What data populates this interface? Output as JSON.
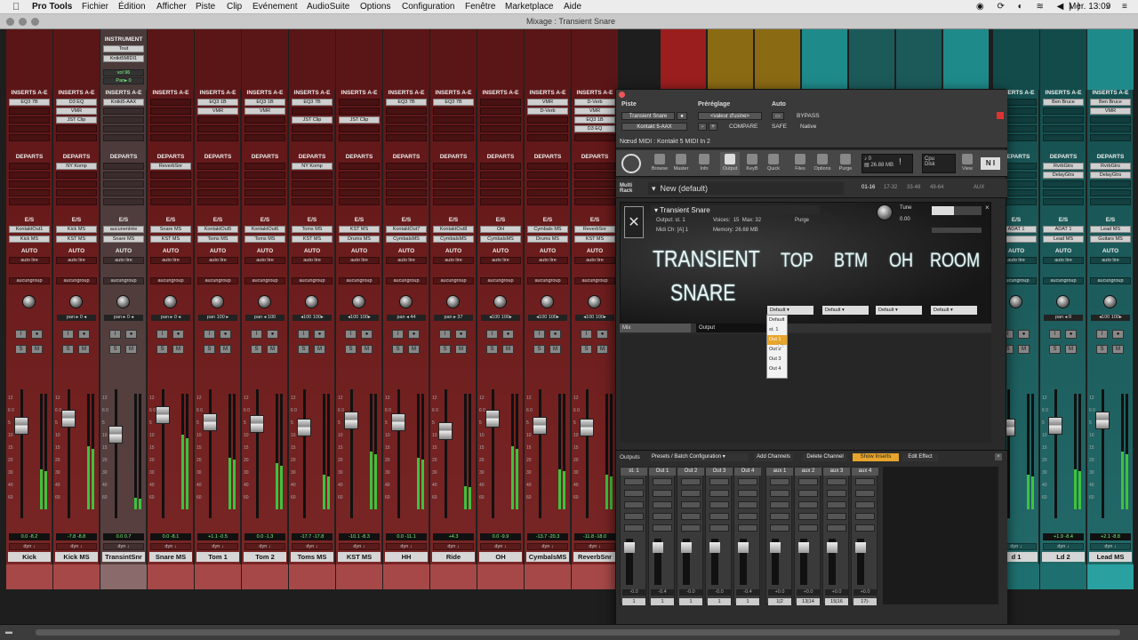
{
  "menubar": {
    "app": "Pro Tools",
    "items": [
      "Fichier",
      "Édition",
      "Afficher",
      "Piste",
      "Clip",
      "Evénement",
      "AudioSuite",
      "Options",
      "Configuration",
      "Fenêtre",
      "Marketplace",
      "Aide"
    ],
    "clock": "Mer. 13:09"
  },
  "window": {
    "title": "Mixage : Transient Snare"
  },
  "sections": {
    "inserts": "INSERTS A-E",
    "sends": "DEPARTS",
    "io": "E/S",
    "auto": "AUTO",
    "instrument": "INSTRUMENT",
    "auto_value": "auto lire",
    "group_value": "aucungroup"
  },
  "instrument_strip": {
    "tout": "Tout",
    "midi_in": "Kntkt5MIDI1",
    "vol": "vol  96",
    "pan": "Pan▸ 0",
    "insert": "Kntkt5-AAX"
  },
  "strips": [
    {
      "name": "Kick",
      "insert": "EQ3 7B",
      "send": "",
      "io_in": "KontaktOut1",
      "io_out": "Kick MS",
      "pan": "",
      "val": "0.0  -8.2",
      "meter": 0.35
    },
    {
      "name": "Kick MS",
      "insert": "D3 EQ",
      "insert2": "VMR",
      "insert3": "JST Clip",
      "send": "NY Komp",
      "io_in": "Kick MS",
      "io_out": "KST MS",
      "pan": "pan  ▸ 0 ◂",
      "val": "-7.8  -8.8",
      "meter": 0.55
    },
    {
      "name": "TransintSnr",
      "insert": "",
      "send": "",
      "io_in": "aucunentrée",
      "io_out": "Snare MS",
      "pan": "pan  ▸ 0 ◂",
      "val": "0.0  0.7",
      "meter": 0.1
    },
    {
      "name": "Snare MS",
      "insert": "",
      "send": "ReverbSnr",
      "io_in": "Snare MS",
      "io_out": "KST MS",
      "pan": "pan  ▸ 0 ◂",
      "val": "0.0  -8.1",
      "meter": 0.65
    },
    {
      "name": "Tom 1",
      "insert": "EQ3 1B",
      "insert2": "VMR",
      "send": "",
      "io_in": "KontaktOut5",
      "io_out": "Toms MS",
      "pan": "pan  100 ▸",
      "val": "+1.1  -0.5",
      "meter": 0.45
    },
    {
      "name": "Tom 2",
      "insert": "EQ3 1B",
      "insert2": "VMR",
      "send": "",
      "io_in": "KontaktOut6",
      "io_out": "Toms MS",
      "pan": "pan  ◂ 100",
      "val": "0.0  -1.3",
      "meter": 0.4
    },
    {
      "name": "Toms MS",
      "insert": "EQ3 7B",
      "insert2": "",
      "insert3": "JST Clip",
      "send": "NY Komp",
      "io_in": "Toms MS",
      "io_out": "KST MS",
      "pan": "◂100  100▸",
      "val": "-17.7  -17.8",
      "meter": 0.3
    },
    {
      "name": "KST MS",
      "insert": "",
      "insert3": "JST Clip",
      "send": "",
      "io_in": "KST MS",
      "io_out": "Drums MS",
      "pan": "◂100  100▸",
      "val": "-10.1  -8.3",
      "meter": 0.5
    },
    {
      "name": "HH",
      "insert": "EQ3 7B",
      "send": "",
      "io_in": "KontaktOut7",
      "io_out": "CymbalsMS",
      "pan": "pan  ◂ 44",
      "val": "0.0  -11.1",
      "meter": 0.45
    },
    {
      "name": "Ride",
      "insert": "EQ3 7B",
      "send": "",
      "io_in": "KontaktOut8",
      "io_out": "CymbalsMS",
      "pan": "pan  ▸ 37",
      "val": "+4.3  ",
      "meter": 0.2
    },
    {
      "name": "OH",
      "insert": "",
      "send": "",
      "io_in": "OH",
      "io_out": "CymbalsMS",
      "pan": "◂100  100▸",
      "val": "0.0  -9.9",
      "meter": 0.55
    },
    {
      "name": "CymbalsMS",
      "insert": "VMR",
      "insert2": "D-Verb",
      "send": "",
      "io_in": "Cymbals MS",
      "io_out": "Drums MS",
      "pan": "◂100  100▸",
      "val": "-13.7  -20.3",
      "meter": 0.35
    },
    {
      "name": "ReverbSnr",
      "insert": "D-Verb",
      "insert2": "VMR",
      "insert3": "EQ3 1B",
      "insert4": "D3 EQ",
      "send": "",
      "io_in": "ReverbSnr",
      "io_out": "KST MS",
      "pan": "◂100  100▸",
      "val": "-11.8  -18.0",
      "meter": 0.3
    }
  ],
  "right_strips": [
    {
      "name": "d 1",
      "insert": "",
      "io_in": "ADAT 1",
      "io_out": "",
      "val": "",
      "meter": 0.3
    },
    {
      "name": "Ld 2",
      "insert": "Ben Bruce",
      "send": "RvrbGtrs",
      "send2": "DelayGtrs",
      "io_in": "ADAT 1",
      "io_out": "Lead MS",
      "pan": "pan  ◂ 0",
      "val": "+1.9  -8.4",
      "meter": 0.35
    },
    {
      "name": "Lead MS",
      "insert": "Ben Bruce",
      "insert2": "VMR",
      "send": "RvrbGtrs",
      "send2": "DelayGtrs",
      "io_in": "Lead MS",
      "io_out": "Guitars MS",
      "pan": "◂100  100▸",
      "val": "+2.1  -8.8",
      "meter": 0.5
    }
  ],
  "plugin": {
    "piste_label": "Piste",
    "preset_label": "Préréglage",
    "auto_label": "Auto",
    "track": "Transient Snare",
    "insert": "Kontakt 5-AAX",
    "preset": "<valeur d'usine>",
    "compare": "COMPARE",
    "safe": "SAFE",
    "bypass": "BYPASS",
    "native": "Native",
    "midi_node": "Nœud MIDI : Kontakt 5 MIDI In 2",
    "toolbar": [
      "Browse",
      "Master",
      "Info",
      "Output",
      "KeyB",
      "Quick",
      "Files",
      "Options",
      "Purge",
      "View"
    ],
    "voices": "0",
    "memory": "26.88 MB",
    "cpu": "Cpu",
    "disk": "Disk",
    "rack_label": "Multi Rack",
    "rack_name": "New (default)",
    "rack_ranges": [
      "01-16",
      "17-32",
      "33-48",
      "49-64"
    ],
    "aux": "AUX",
    "instrument": {
      "name": "Transient Snare",
      "output": "Output:  st. 1",
      "voices": "Voices:",
      "voices_val": "15",
      "max": "Max:",
      "max_val": "32",
      "purge": "Purge",
      "midi": "Midi Ch:  [A]  1",
      "memory": "Memory:",
      "memory_val": "26.68 MB",
      "tune": "Tune",
      "tune_val": "0.00"
    },
    "chalk": {
      "line1": "TRANSIENT",
      "line2": "SNARE",
      "top": "TOP",
      "btm": "BTM",
      "oh": "OH",
      "room": "ROOM"
    },
    "dropdown_default": "Default",
    "menu": [
      "Default",
      "st. 1",
      "Out 1",
      "Out 2",
      "Out 3",
      "Out 4"
    ],
    "menu_selected": "Out 1",
    "tabs": [
      "Mix",
      "Output"
    ],
    "outputs_bar": {
      "title": "Outputs",
      "presets": "Presets / Batch Configuration",
      "add": "Add Channels",
      "del": "Delete Channel",
      "show": "Show Inserts",
      "edit": "Edit Effect"
    },
    "channels": [
      {
        "name": "st. 1",
        "val": "-0.0",
        "n": "1"
      },
      {
        "name": "Out 1",
        "val": "-0.4",
        "n": "1"
      },
      {
        "name": "Out 2",
        "val": "-0.0",
        "n": "1"
      },
      {
        "name": "Out 3",
        "val": "-0.0",
        "n": "1"
      },
      {
        "name": "Out 4",
        "val": "-0.4",
        "n": "1"
      },
      {
        "name": "aux 1",
        "val": "+0.0",
        "n": "1|2"
      },
      {
        "name": "aux 2",
        "val": "+0.0",
        "n": "13|14"
      },
      {
        "name": "aux 3",
        "val": "+0.0",
        "n": "15|16"
      },
      {
        "name": "aux 4",
        "val": "+0.0",
        "n": "17|-"
      }
    ]
  },
  "colors": {
    "red": "#7a2626",
    "teal": "#1c5a5a",
    "orange": "#8b6a14",
    "bright_red": "#9a1e1e",
    "cyan": "#1f8a8a"
  }
}
